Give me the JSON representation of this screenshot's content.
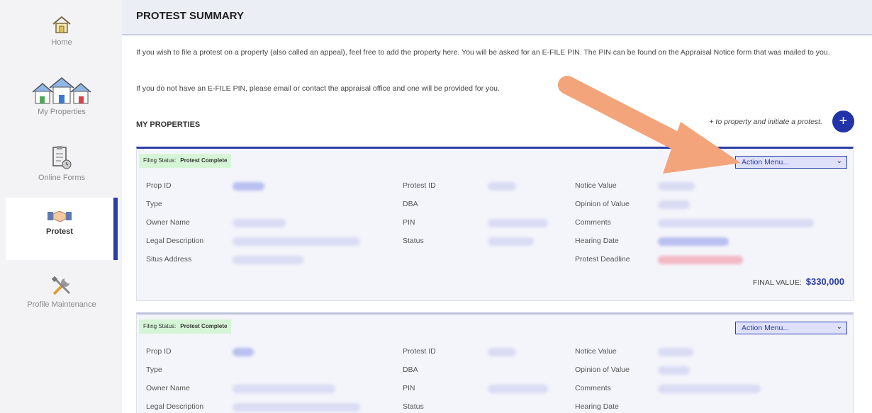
{
  "sidebar": {
    "items": [
      {
        "label": "Home",
        "icon": "home-icon"
      },
      {
        "label": "My Properties",
        "icon": "houses-icon"
      },
      {
        "label": "Online Forms",
        "icon": "forms-icon"
      },
      {
        "label": "Protest",
        "icon": "handshake-icon",
        "active": true
      },
      {
        "label": "Profile Maintenance",
        "icon": "tools-icon"
      }
    ]
  },
  "page": {
    "title": "PROTEST SUMMARY",
    "intro1": "If you wish to file a protest on a property (also called an appeal), feel free to add the property here. You will be asked for an E-FILE PIN. The PIN can be found on the Appraisal Notice form that was mailed to you.",
    "intro2": "If you do not have an E-FILE PIN, please email or contact the appraisal office and one will be provided for you.",
    "section_title": "MY PROPERTIES",
    "add_hint": "+ to        property and initiate a protest.",
    "add_button": "+"
  },
  "cards": [
    {
      "filing_label": "Filing Status:",
      "filing_value": "Protest Complete",
      "action_menu": "Action Menu...",
      "labels": {
        "prop_id": "Prop ID",
        "type": "Type",
        "owner": "Owner Name",
        "legal": "Legal Description",
        "situs": "Situs Address",
        "protest_id": "Protest ID",
        "dba": "DBA",
        "pin": "PIN",
        "status": "Status",
        "notice": "Notice Value",
        "opinion": "Opinion of Value",
        "comments": "Comments",
        "hearing": "Hearing Date",
        "deadline": "Protest Deadline"
      },
      "final_label": "FINAL VALUE:",
      "final_value": "$330,000"
    },
    {
      "filing_label": "Filing Status:",
      "filing_value": "Protest Complete",
      "action_menu": "Action Menu...",
      "labels": {
        "prop_id": "Prop ID",
        "type": "Type",
        "owner": "Owner Name",
        "legal": "Legal Description",
        "protest_id": "Protest ID",
        "dba": "DBA",
        "pin": "PIN",
        "status": "Status",
        "notice": "Notice Value",
        "opinion": "Opinion of Value",
        "comments": "Comments",
        "hearing": "Hearing Date"
      }
    }
  ],
  "colors": {
    "accent": "#2a3ea6",
    "arrow": "#f4a47a",
    "filing_bg": "#d6f5d6"
  }
}
